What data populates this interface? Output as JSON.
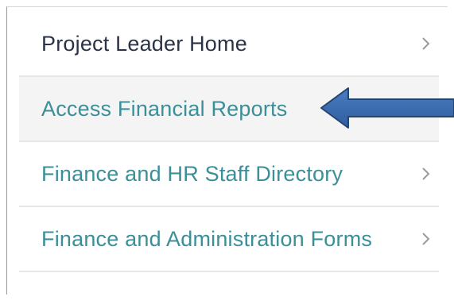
{
  "menu": {
    "items": [
      {
        "label": "Project Leader Home",
        "icon": "chevron-right-icon"
      },
      {
        "label": "Access Financial Reports",
        "icon": null
      },
      {
        "label": "Finance and HR Staff Directory",
        "icon": "chevron-right-icon"
      },
      {
        "label": "Finance and Administration Forms",
        "icon": "chevron-right-icon"
      }
    ]
  },
  "annotation": {
    "arrow_icon": "left-arrow-icon",
    "arrow_color": "#3567a9"
  },
  "colors": {
    "link_teal": "#3b8f99",
    "dark_text": "#2b3446",
    "divider": "#e7e7e7"
  }
}
